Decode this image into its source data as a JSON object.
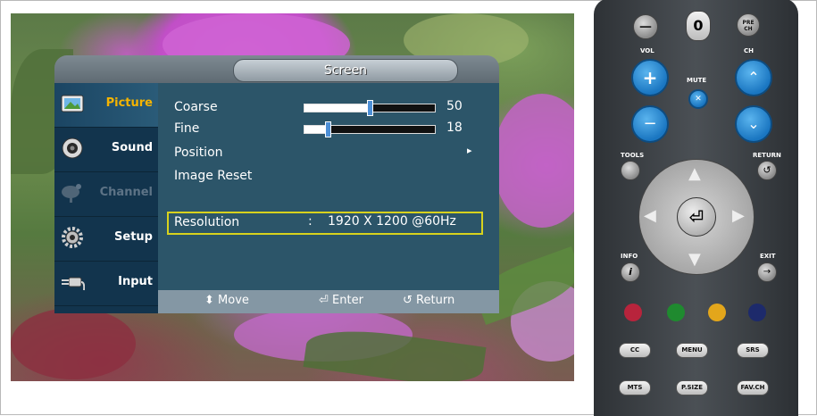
{
  "osd": {
    "title": "Screen",
    "nav": [
      {
        "label": "Picture",
        "icon": "picture-icon",
        "state": "active"
      },
      {
        "label": "Sound",
        "icon": "speaker-icon",
        "state": "normal"
      },
      {
        "label": "Channel",
        "icon": "satellite-dish-icon",
        "state": "disabled"
      },
      {
        "label": "Setup",
        "icon": "gear-icon",
        "state": "normal"
      },
      {
        "label": "Input",
        "icon": "plug-icon",
        "state": "normal"
      }
    ],
    "rows": {
      "coarse": {
        "label": "Coarse",
        "value": "50",
        "level": 0.5
      },
      "fine": {
        "label": "Fine",
        "value": "18",
        "level": 0.18
      },
      "position": {
        "label": "Position",
        "arrow": "▸"
      },
      "image_reset": {
        "label": "Image Reset"
      },
      "resolution": {
        "label": "Resolution",
        "separator": ":",
        "value": "1920 X 1200 @60Hz"
      }
    },
    "footer": {
      "move": "Move",
      "enter": "Enter",
      "return": "Return"
    }
  },
  "remote": {
    "top": {
      "dash": "—",
      "zero": "0",
      "prech": "PRE\nCH"
    },
    "vol": "VOL",
    "ch": "CH",
    "mute": "MUTE",
    "tools": "TOOLS",
    "return": "RETURN",
    "info": "INFO",
    "exit": "EXIT",
    "cc": "CC",
    "menu": "MENU",
    "srs": "SRS",
    "mts": "MTS",
    "psize": "P.SIZE",
    "favch": "FAV.CH"
  }
}
